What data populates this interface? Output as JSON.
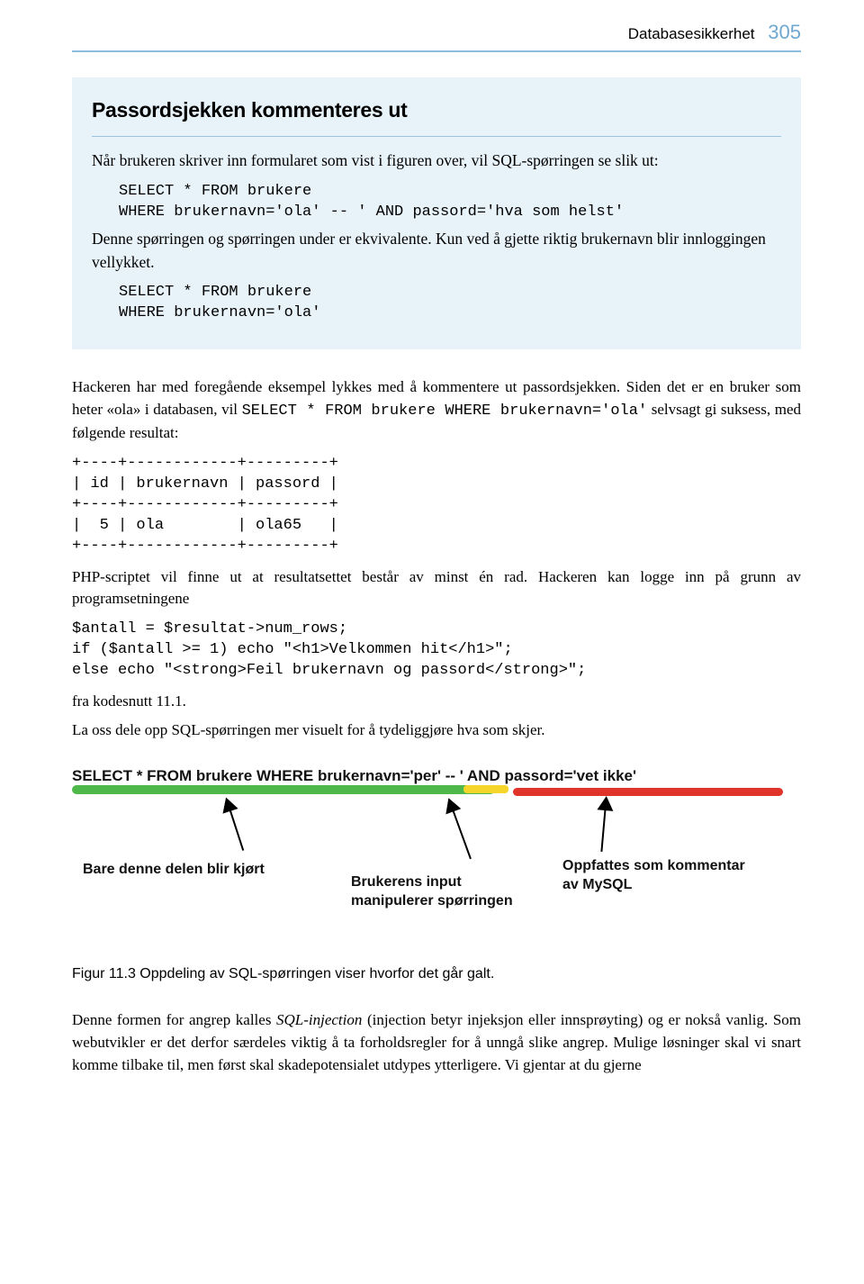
{
  "header": {
    "chapter": "Databasesikkerhet",
    "page": "305"
  },
  "box": {
    "title": "Passordsjekken kommenteres ut",
    "intro": "Når brukeren skriver inn formularet som vist i figuren over, vil SQL-spørringen se slik ut:",
    "code1": "SELECT * FROM brukere\nWHERE brukernavn='ola' -- ' AND passord='hva som helst'",
    "mid": "Denne spørringen og spørringen under er ekvivalente. Kun ved å gjette riktig brukernavn blir innloggingen vellykket.",
    "code2": "SELECT * FROM brukere\nWHERE brukernavn='ola'"
  },
  "para1a": "Hackeren har med foregående eksempel lykkes med å kommentere ut passordsjekken. Siden det er en bruker som heter «ola» i databasen, vil ",
  "para1code": "SELECT * FROM brukere WHERE brukernavn='ola'",
  "para1b": " selvsagt gi suksess, med følgende resultat:",
  "table": "+----+------------+---------+\n| id | brukernavn | passord |\n+----+------------+---------+\n|  5 | ola        | ola65   |\n+----+------------+---------+",
  "para2": "PHP-scriptet vil finne ut at resultatsettet består av minst én rad. Hackeren kan logge inn på grunn av programsetningene",
  "php": "$antall = $resultat->num_rows;\nif ($antall >= 1) echo \"<h1>Velkommen hit</h1>\";\nelse echo \"<strong>Feil brukernavn og passord</strong>\";",
  "para3": "fra kodesnutt 11.1.",
  "para4": "La oss dele opp SQL-spørringen mer visuelt for å tydeliggjøre hva som skjer.",
  "figure": {
    "sql": "SELECT * FROM brukere WHERE brukernavn='per' -- ' AND passord='vet ikke'",
    "callout1": "Bare denne delen blir kjørt",
    "callout2": "Brukerens input\nmanipulerer spørringen",
    "callout3": "Oppfattes som kommentar\nav MySQL",
    "caption": "Figur 11.3  Oppdeling av SQL-spørringen viser hvorfor det går galt."
  },
  "para5a": "Denne formen for angrep kalles ",
  "para5em": "SQL-injection",
  "para5b": " (injection betyr injeksjon eller innsprøyting) og er nokså vanlig. Som webutvikler er det derfor særdeles viktig å ta forholdsregler for å unngå slike angrep. Mulige løsninger skal vi snart komme tilbake til, men først skal skadepotensialet utdypes ytterligere. Vi gjentar at du gjerne"
}
